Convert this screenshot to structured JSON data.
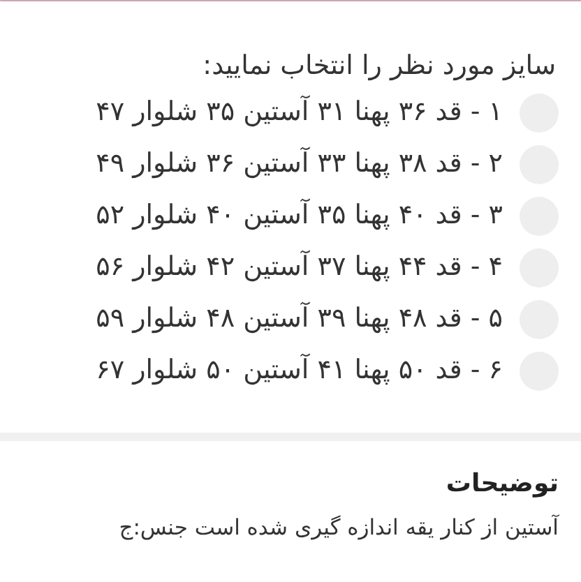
{
  "prompt": "سایز مورد نظر را انتخاب نمایید:",
  "options": [
    {
      "label": "۱ - قد ۳۶ پهنا ۳۱ آستین ۳۵ شلوار ۴۷",
      "selected": false
    },
    {
      "label": "۲ - قد ۳۸ پهنا ۳۳ آستین ۳۶ شلوار ۴۹",
      "selected": false
    },
    {
      "label": "۳ - قد ۴۰ پهنا ۳۵ آستین ۴۰ شلوار ۵۲",
      "selected": false
    },
    {
      "label": "۴ - قد ۴۴ پهنا ۳۷ آستین ۴۲ شلوار ۵۶",
      "selected": false
    },
    {
      "label": "۵ - قد ۴۸ پهنا ۳۹ آستین ۴۸ شلوار ۵۹",
      "selected": false
    },
    {
      "label": "۶ - قد ۵۰ پهنا ۴۱ آستین ۵۰ شلوار ۶۷",
      "selected": false
    }
  ],
  "description": {
    "title": "توضیحات",
    "text": "آستین از کنار یقه اندازه گیری شده است جنس:ج"
  }
}
